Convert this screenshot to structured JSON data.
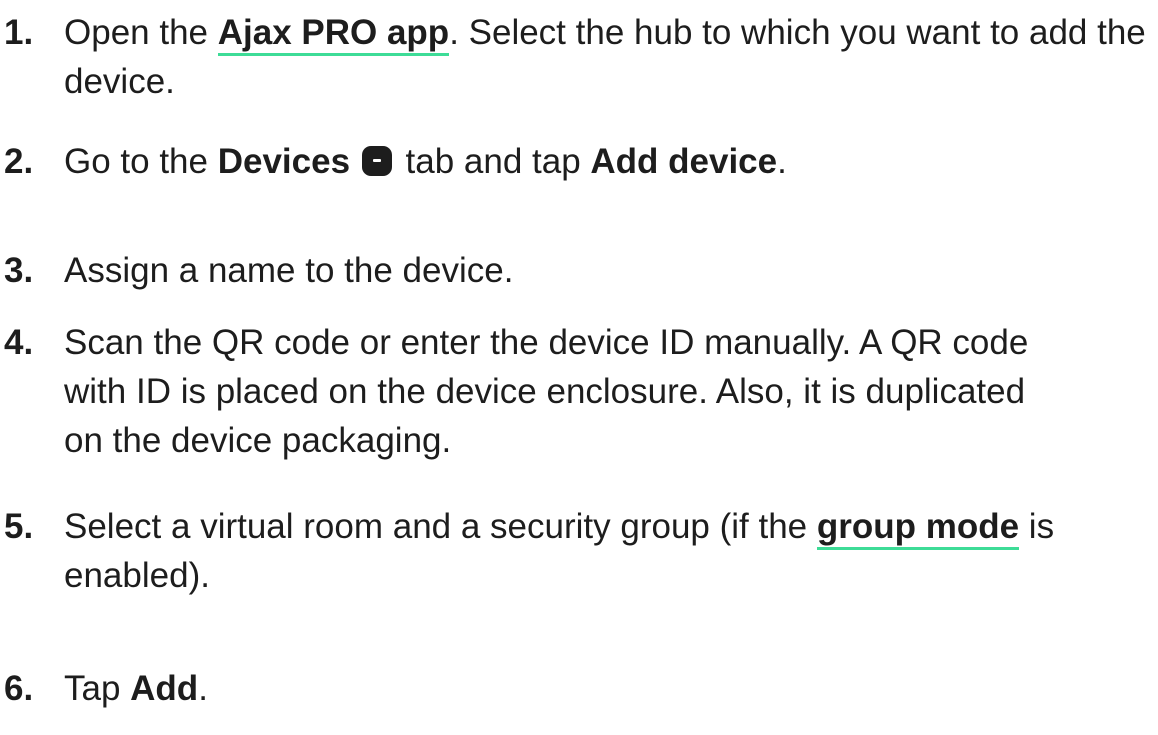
{
  "steps": [
    {
      "num": "1.",
      "parts": [
        "Open the ",
        "Ajax PRO app",
        ". Select the hub to which you want to add the device."
      ]
    },
    {
      "num": "2.",
      "parts": [
        "Go to the ",
        "Devices",
        " tab and tap ",
        "Add device",
        "."
      ],
      "icon": "devices-tab-icon"
    },
    {
      "num": "3.",
      "parts": [
        "Assign a name to the device."
      ]
    },
    {
      "num": "4.",
      "parts": [
        "Scan the QR code or enter the device ID manually. A QR code with ID is placed on the device enclosure. Also, it is duplicated on the device packaging."
      ]
    },
    {
      "num": "5.",
      "parts": [
        "Select a virtual room and a security group (if the ",
        "group mode",
        " is enabled)."
      ]
    },
    {
      "num": "6.",
      "parts": [
        "Tap ",
        "Add",
        "."
      ]
    }
  ],
  "colors": {
    "text": "#1d1d1d",
    "link_underline": "#3ddc97"
  }
}
